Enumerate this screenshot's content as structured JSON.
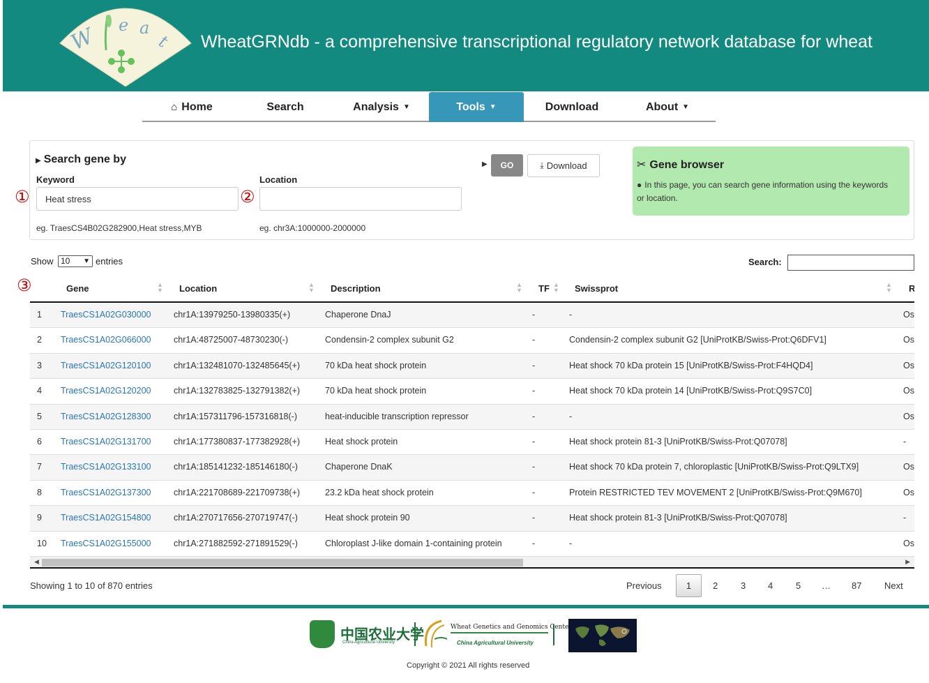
{
  "header": {
    "logo_text": "Wheat",
    "title": "WheatGRNdb - a comprehensive transcriptional regulatory network database for wheat"
  },
  "nav": {
    "items": [
      {
        "label": "Home",
        "icon": "home-icon"
      },
      {
        "label": "Search"
      },
      {
        "label": "Analysis",
        "dropdown": true
      },
      {
        "label": "Tools",
        "dropdown": true,
        "active": true
      },
      {
        "label": "Download"
      },
      {
        "label": "About",
        "dropdown": true
      }
    ]
  },
  "search_panel": {
    "title": "Search gene by",
    "keyword_label": "Keyword",
    "keyword_value": "Heat stress",
    "keyword_hint": "eg. TraesCS4B02G282900,Heat stress,MYB",
    "location_label": "Location",
    "location_value": "",
    "location_hint": "eg. chr3A:1000000-2000000",
    "go_label": "GO",
    "download_label": "Download"
  },
  "gene_browser": {
    "title": "Gene browser",
    "text": "In this page, you can search gene information using the keywords or location."
  },
  "markers": [
    "①",
    "②",
    "③"
  ],
  "table_controls": {
    "show_label": "Show",
    "entries_value": "10",
    "entries_label": "entries",
    "search_label": "Search:"
  },
  "table": {
    "columns": [
      "Gene",
      "Location",
      "Description",
      "TF",
      "Swissprot",
      "R"
    ],
    "rows": [
      {
        "n": "1",
        "gene": "TraesCS1A02G030000",
        "location": "chr1A:13979250-13980335(+)",
        "description": "Chaperone DnaJ",
        "tf": "-",
        "swissprot": "-",
        "r": "Os"
      },
      {
        "n": "2",
        "gene": "TraesCS1A02G066000",
        "location": "chr1A:48725007-48730230(-)",
        "description": "Condensin-2 complex subunit G2",
        "tf": "-",
        "swissprot": "Condensin-2 complex subunit G2 [UniProtKB/Swiss-Prot:Q6DFV1]",
        "r": "Os"
      },
      {
        "n": "3",
        "gene": "TraesCS1A02G120100",
        "location": "chr1A:132481070-132485645(+)",
        "description": "70 kDa heat shock protein",
        "tf": "-",
        "swissprot": "Heat shock 70 kDa protein 15 [UniProtKB/Swiss-Prot:F4HQD4]",
        "r": "Os"
      },
      {
        "n": "4",
        "gene": "TraesCS1A02G120200",
        "location": "chr1A:132783825-132791382(+)",
        "description": "70 kDa heat shock protein",
        "tf": "-",
        "swissprot": "Heat shock 70 kDa protein 14 [UniProtKB/Swiss-Prot:Q9S7C0]",
        "r": "Os"
      },
      {
        "n": "5",
        "gene": "TraesCS1A02G128300",
        "location": "chr1A:157311796-157316818(-)",
        "description": "heat-inducible transcription repressor",
        "tf": "-",
        "swissprot": "-",
        "r": "Os"
      },
      {
        "n": "6",
        "gene": "TraesCS1A02G131700",
        "location": "chr1A:177380837-177382928(+)",
        "description": "Heat shock protein",
        "tf": "-",
        "swissprot": "Heat shock protein 81-3 [UniProtKB/Swiss-Prot:Q07078]",
        "r": "-"
      },
      {
        "n": "7",
        "gene": "TraesCS1A02G133100",
        "location": "chr1A:185141232-185146180(-)",
        "description": "Chaperone DnaK",
        "tf": "-",
        "swissprot": "Heat shock 70 kDa protein 7, chloroplastic [UniProtKB/Swiss-Prot:Q9LTX9]",
        "r": "Os"
      },
      {
        "n": "8",
        "gene": "TraesCS1A02G137300",
        "location": "chr1A:221708689-221709738(+)",
        "description": "23.2 kDa heat shock protein",
        "tf": "-",
        "swissprot": "Protein RESTRICTED TEV MOVEMENT 2 [UniProtKB/Swiss-Prot:Q9M670]",
        "r": "Os"
      },
      {
        "n": "9",
        "gene": "TraesCS1A02G154800",
        "location": "chr1A:270717656-270719747(-)",
        "description": "Heat shock protein 90",
        "tf": "-",
        "swissprot": "Heat shock protein 81-3 [UniProtKB/Swiss-Prot:Q07078]",
        "r": "-"
      },
      {
        "n": "10",
        "gene": "TraesCS1A02G155000",
        "location": "chr1A:271882592-271891529(-)",
        "description": "Chloroplast J-like domain 1-containing protein",
        "tf": "-",
        "swissprot": "-",
        "r": "Os"
      }
    ]
  },
  "pagination": {
    "info": "Showing 1 to 10 of 870 entries",
    "previous": "Previous",
    "pages": [
      "1",
      "2",
      "3",
      "4",
      "5",
      "…",
      "87"
    ],
    "next": "Next"
  },
  "footer": {
    "cau_name_cn": "中国农业大学",
    "cau_name_en": "China Agricultural University",
    "wggc_name": "Wheat Genetics and Genomics Center",
    "wggc_sub": "China Agricultural University",
    "copyright": "Copyright © 2021 All rights reserved"
  },
  "colors": {
    "header_bg": "#128a80",
    "nav_active": "#3797b9",
    "gene_browser_bg": "#b2e9ae",
    "link": "#2a77b6",
    "marker": "#d10000"
  }
}
